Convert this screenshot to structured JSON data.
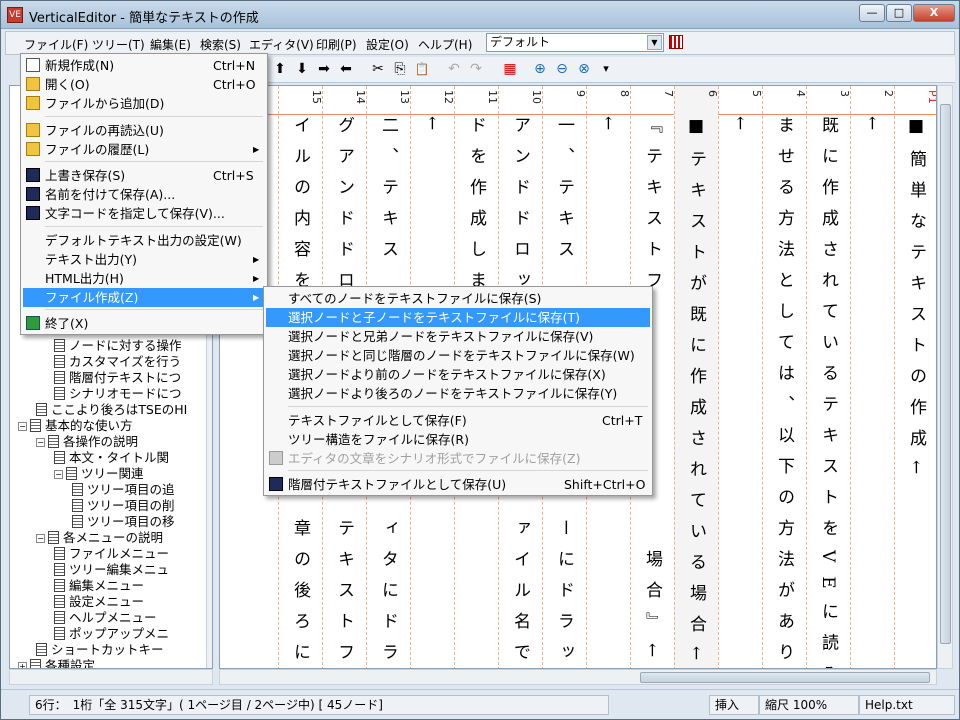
{
  "window": {
    "title": "VerticalEditor - 簡単なテキストの作成",
    "app_icon_text": "VE",
    "min_glyph": "—",
    "max_glyph": "□",
    "close_glyph": "X"
  },
  "menubar": {
    "items": [
      "ファイル(F)",
      "ツリー(T)",
      "編集(E)",
      "検索(S)",
      "エディタ(V)",
      "印刷(P)",
      "設定(O)",
      "ヘルプ(H)"
    ],
    "combo_value": "デフォルト",
    "combo_arrow": "▼"
  },
  "toolbar": {
    "up": "⬆",
    "down": "⬇",
    "right": "➡",
    "left": "⬅",
    "cut": "✂",
    "copy": "⎘",
    "paste": "📋",
    "undo": "↶",
    "redo": "↷",
    "zoom_in": "⊕",
    "zoom_out": "⊖",
    "zoom_reset": "⊗",
    "more": "▾"
  },
  "file_menu": {
    "items": [
      {
        "label": "新規作成(N)",
        "shortcut": "Ctrl+N",
        "icon": "doc"
      },
      {
        "label": "開く(O)",
        "shortcut": "Ctrl+O",
        "icon": "folder"
      },
      {
        "label": "ファイルから追加(D)",
        "shortcut": "",
        "icon": "folder"
      },
      {
        "label": "ファイルの再読込(U)",
        "shortcut": "",
        "icon": "folder"
      },
      {
        "label": "ファイルの履歴(L)",
        "shortcut": "▶",
        "icon": "folder"
      },
      {
        "label": "上書き保存(S)",
        "shortcut": "Ctrl+S",
        "icon": "save"
      },
      {
        "label": "名前を付けて保存(A)...",
        "shortcut": "",
        "icon": "save"
      },
      {
        "label": "文字コードを指定して保存(V)...",
        "shortcut": "",
        "icon": "save"
      },
      {
        "label": "デフォルトテキスト出力の設定(W)",
        "shortcut": "",
        "icon": ""
      },
      {
        "label": "テキスト出力(Y)",
        "shortcut": "▶",
        "icon": ""
      },
      {
        "label": "HTML出力(H)",
        "shortcut": "▶",
        "icon": ""
      },
      {
        "label": "ファイル作成(Z)",
        "shortcut": "▶",
        "icon": ""
      },
      {
        "label": "終了(X)",
        "shortcut": "",
        "icon": "exit"
      }
    ]
  },
  "submenu": {
    "items": [
      {
        "label": "すべてのノードをテキストファイルに保存(S)",
        "shortcut": ""
      },
      {
        "label": "選択ノードと子ノードをテキストファイルに保存(T)",
        "shortcut": ""
      },
      {
        "label": "選択ノードと兄弟ノードをテキストファイルに保存(V)",
        "shortcut": ""
      },
      {
        "label": "選択ノードと同じ階層のノードをテキストファイルに保存(W)",
        "shortcut": ""
      },
      {
        "label": "選択ノードより前のノードをテキストファイルに保存(X)",
        "shortcut": ""
      },
      {
        "label": "選択ノードより後ろのノードをテキストファイルに保存(Y)",
        "shortcut": ""
      },
      {
        "label": "テキストファイルとして保存(F)",
        "shortcut": "Ctrl+T"
      },
      {
        "label": "ツリー構造をファイルに保存(R)",
        "shortcut": ""
      },
      {
        "label": "エディタの文章をシナリオ形式でファイルに保存(Z)",
        "shortcut": ""
      },
      {
        "label": "階層付テキストファイルとして保存(U)",
        "shortcut": "Shift+Ctrl+O"
      }
    ]
  },
  "tree": {
    "items": [
      {
        "label": "ノードに対する操作",
        "indent": 2
      },
      {
        "label": "カスタマイズを行う",
        "indent": 2
      },
      {
        "label": "階層付テキストにつ",
        "indent": 2
      },
      {
        "label": "シナリオモードにつ",
        "indent": 2
      },
      {
        "label": "ここより後ろはTSEのHI",
        "indent": 1
      },
      {
        "label": "基本的な使い方",
        "indent": 0
      },
      {
        "label": "各操作の説明",
        "indent": 1
      },
      {
        "label": "本文・タイトル関",
        "indent": 2
      },
      {
        "label": "ツリー関連",
        "indent": 2
      },
      {
        "label": "ツリー項目の追",
        "indent": 3
      },
      {
        "label": "ツリー項目の削",
        "indent": 3
      },
      {
        "label": "ツリー項目の移",
        "indent": 3
      },
      {
        "label": "各メニューの説明",
        "indent": 1
      },
      {
        "label": "ファイルメニュー",
        "indent": 2
      },
      {
        "label": "ツリー編集メニュ",
        "indent": 2
      },
      {
        "label": "編集メニュー",
        "indent": 2
      },
      {
        "label": "設定メニュー",
        "indent": 2
      },
      {
        "label": "ヘルプメニュー",
        "indent": 2
      },
      {
        "label": "ポップアップメニ",
        "indent": 2
      },
      {
        "label": "ショートカットキー",
        "indent": 1
      },
      {
        "label": "各種設定",
        "indent": 0
      }
    ]
  },
  "editor": {
    "columns": [
      {
        "num": "P1",
        "text": "■簡単なテキストの作成←"
      },
      {
        "num": "2",
        "text": "←"
      },
      {
        "num": "3",
        "text": "既に作成されているテキストをVEに読み込"
      },
      {
        "num": "4",
        "text": "ませる方法としては、以下の方法がありま"
      },
      {
        "num": "5",
        "text": "←"
      },
      {
        "num": "6",
        "text": "■テキストが既に作成されている場合←"
      },
      {
        "num": "7",
        "text": "『テキストフ　　　　　　　　場合』←"
      },
      {
        "num": "8",
        "text": "←"
      },
      {
        "num": "9",
        "text": "一、テキス　　　　　　　　ーにドラッグ"
      },
      {
        "num": "10",
        "text": "アンドドロッ　　　　　　　ァイル名でノ"
      },
      {
        "num": "11",
        "text": "ドを作成しま"
      },
      {
        "num": "12",
        "text": "←"
      },
      {
        "num": "13",
        "text": "二、テキス　　　　　　　　ィタにドラッ"
      },
      {
        "num": "14",
        "text": "グアンドドロ　　　　　　　テキストファ"
      },
      {
        "num": "15",
        "text": "イルの内容を　　　　　　　章の後ろに追"
      }
    ]
  },
  "status": {
    "position": "6行：　1桁「全 315文字」( 1ページ目 / 2ページ中) [ 45ノード]",
    "mode": "挿入",
    "zoom": "縮尺 100%",
    "file": "Help.txt"
  }
}
